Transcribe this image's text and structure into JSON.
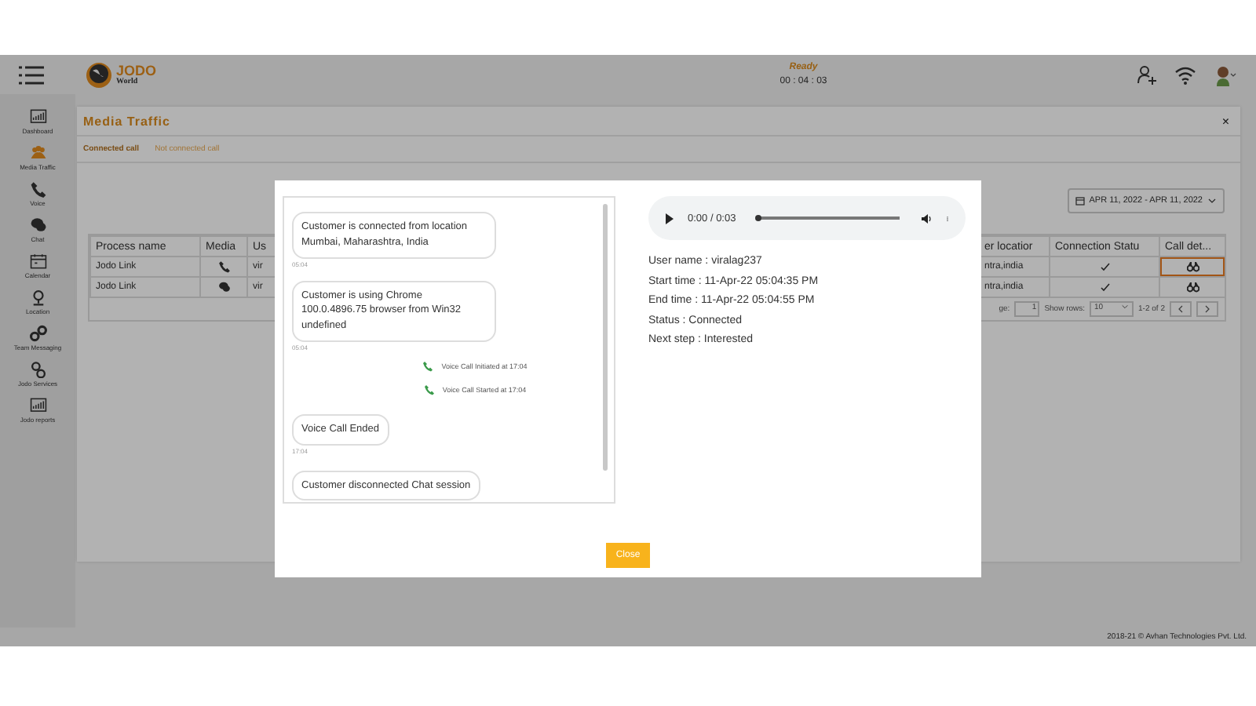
{
  "header": {
    "logo_title": "JODO",
    "logo_subtitle": "World",
    "status": "Ready",
    "timer": "00 : 04 : 03"
  },
  "sidebar": {
    "items": [
      {
        "label": "Dashboard",
        "selected": false
      },
      {
        "label": "Media Traffic",
        "selected": true
      },
      {
        "label": "Voice",
        "selected": false
      },
      {
        "label": "Chat",
        "selected": false
      },
      {
        "label": "Calendar",
        "selected": false
      },
      {
        "label": "Location",
        "selected": false
      },
      {
        "label": "Team Messaging",
        "selected": false
      },
      {
        "label": "Jodo Services",
        "selected": false
      },
      {
        "label": "Jodo reports",
        "selected": false
      }
    ]
  },
  "panel": {
    "title": "Media Traffic",
    "close": "×",
    "tabs": [
      {
        "label": "Connected call",
        "selected": true
      },
      {
        "label": "Not connected call",
        "selected": false
      }
    ]
  },
  "date_range": "APR 11, 2022 - APR 11, 2022",
  "table": {
    "columns": [
      "Process name",
      "Media",
      "Us",
      "er locatior",
      "Connection Statu",
      "Call det..."
    ],
    "rows": [
      {
        "process": "Jodo Link",
        "kind": "voice",
        "user": "vir",
        "location": "ntra,india",
        "connected": true,
        "highlighted": true
      },
      {
        "process": "Jodo Link",
        "kind": "chat",
        "user": "vir",
        "location": "ntra,india",
        "connected": true,
        "highlighted": false
      }
    ],
    "pager": {
      "page_label": "ge:",
      "page": "1",
      "rows_label": "Show rows:",
      "rows": "10",
      "range": "1-2 of 2"
    }
  },
  "modal": {
    "messages": [
      {
        "kind": "bubble",
        "text": "Customer is connected from location Mumbai, Maharashtra, India",
        "time": "05:04"
      },
      {
        "kind": "bubble",
        "text": "Customer is using Chrome 100.0.4896.75 browser from Win32 undefined",
        "time": "05:04"
      },
      {
        "kind": "event",
        "text": "Voice Call Initiated at 17:04"
      },
      {
        "kind": "event",
        "text": "Voice Call Started at 17:04"
      },
      {
        "kind": "bubble",
        "text": "Voice Call Ended",
        "time": "17:04"
      },
      {
        "kind": "bubble",
        "text": "Customer disconnected Chat session"
      }
    ],
    "player": {
      "time": "0:00 / 0:03",
      "level": 0
    },
    "details": [
      "User name : viralag237",
      "Start time : 11-Apr-22 05:04:35 PM",
      "End time : 11-Apr-22 05:04:55 PM",
      "Status : Connected",
      "Next step : Interested"
    ],
    "close_button": "Close"
  },
  "footer": "2018-21 © Avhan Technologies Pvt. Ltd."
}
